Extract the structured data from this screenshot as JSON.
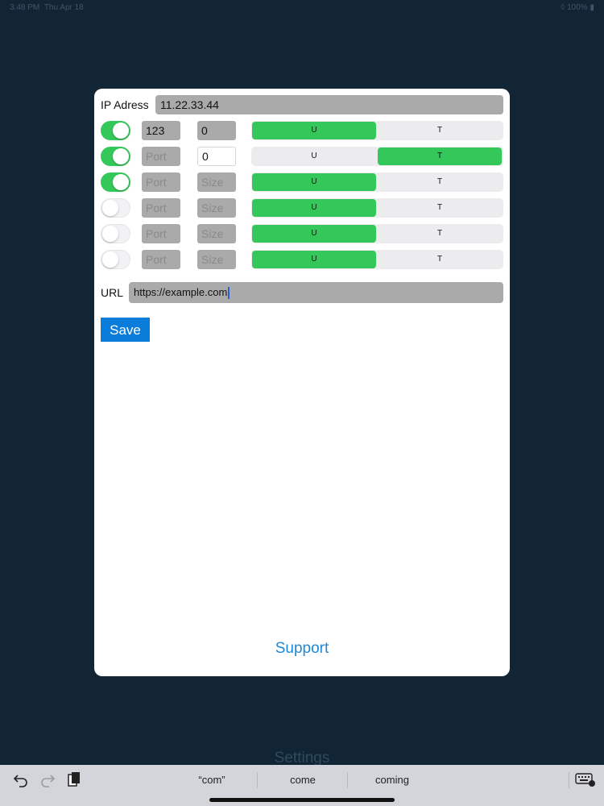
{
  "status": {
    "time": "3:48 PM",
    "date": "Thu Apr 18",
    "battery": "100%"
  },
  "background_title": "Settings",
  "ip": {
    "label": "IP Adress",
    "value": "11.22.33.44"
  },
  "rules": [
    {
      "enabled": true,
      "port": "123",
      "port_placeholder": "Port",
      "size": "0",
      "size_placeholder": "Size",
      "size_style": "grey",
      "selected": "U"
    },
    {
      "enabled": true,
      "port": "",
      "port_placeholder": "Port",
      "size": "0",
      "size_placeholder": "Size",
      "size_style": "white",
      "selected": "T"
    },
    {
      "enabled": true,
      "port": "",
      "port_placeholder": "Port",
      "size": "",
      "size_placeholder": "Size",
      "size_style": "grey",
      "selected": "U"
    },
    {
      "enabled": false,
      "port": "",
      "port_placeholder": "Port",
      "size": "",
      "size_placeholder": "Size",
      "size_style": "grey",
      "selected": "U"
    },
    {
      "enabled": false,
      "port": "",
      "port_placeholder": "Port",
      "size": "",
      "size_placeholder": "Size",
      "size_style": "grey",
      "selected": "U"
    },
    {
      "enabled": false,
      "port": "",
      "port_placeholder": "Port",
      "size": "",
      "size_placeholder": "Size",
      "size_style": "grey",
      "selected": "U"
    }
  ],
  "segment_labels": {
    "u": "U",
    "t": "T"
  },
  "url": {
    "label": "URL",
    "value": "https://example.com"
  },
  "save_label": "Save",
  "support_label": "Support",
  "keyboard": {
    "suggestions": [
      "“com”",
      "come",
      "coming"
    ],
    "icons": [
      "undo-icon",
      "redo-icon",
      "clipboard-icon",
      "keyboard-dismiss-icon"
    ]
  },
  "colors": {
    "accent": "#0a7cd9",
    "toggle_on": "#34c759",
    "field_bg": "#aaaaaa",
    "background": "#122535"
  }
}
